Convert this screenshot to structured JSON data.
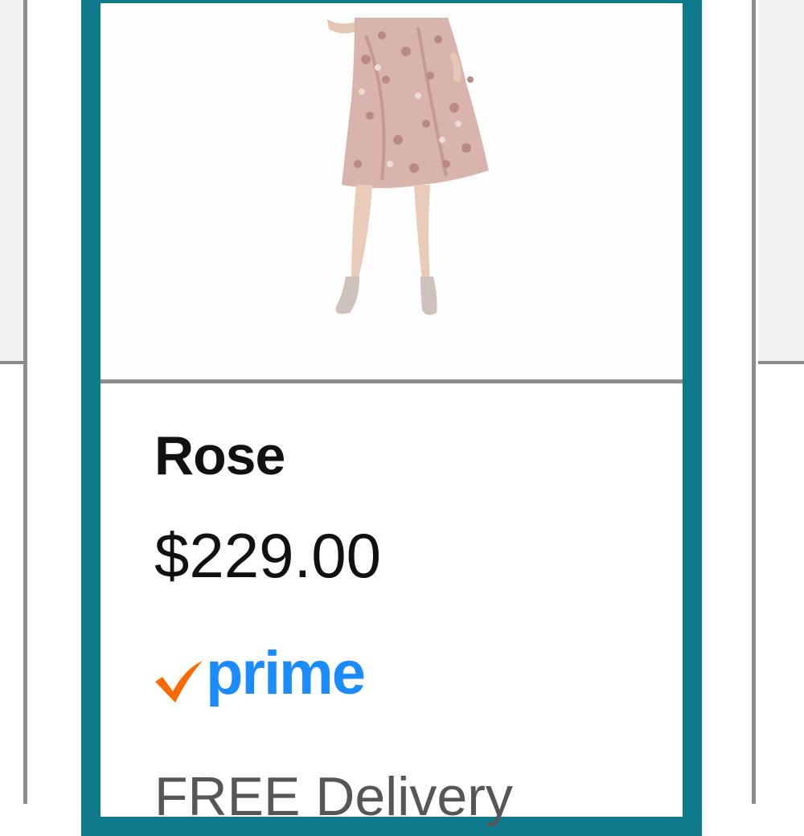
{
  "product": {
    "title": "Rose",
    "price": "$229.00",
    "prime_label": "prime",
    "delivery_text": "FREE Delivery"
  },
  "icons": {
    "prime_check": "prime-check-icon",
    "image": "dress-photo"
  },
  "colors": {
    "card_border": "#0f7a8c",
    "prime_blue": "#1a8cff",
    "prime_check": "#ff6a00",
    "neighbor_border": "#8d8d8d"
  }
}
